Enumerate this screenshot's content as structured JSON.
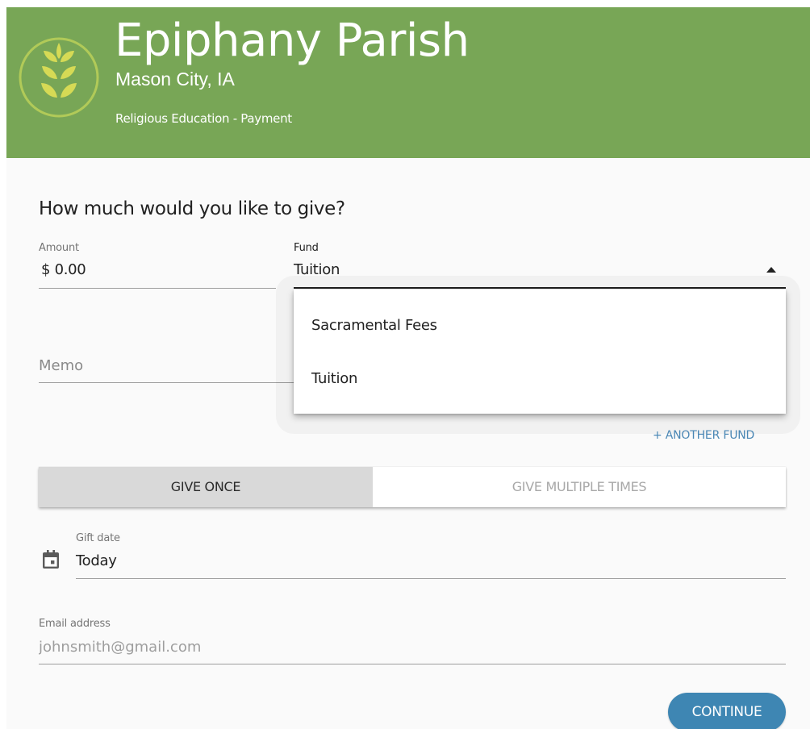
{
  "header": {
    "title": "Epiphany Parish",
    "location": "Mason City, IA",
    "page_name": "Religious Education - Payment",
    "logo_icon": "wheat-icon",
    "background_color": "#78a656"
  },
  "form": {
    "question": "How much would you like to give?",
    "amount": {
      "label": "Amount",
      "currency": "$",
      "value": "0.00"
    },
    "fund": {
      "label": "Fund",
      "selected": "Tuition",
      "options": [
        "Sacramental Fees",
        "Tuition"
      ],
      "dropdown_open": true
    },
    "memo": {
      "placeholder": "Memo"
    },
    "another_fund_link": "+ ANOTHER FUND",
    "frequency": {
      "once_label": "GIVE ONCE",
      "multiple_label": "GIVE MULTIPLE TIMES",
      "selected": "once"
    },
    "gift_date": {
      "label": "Gift date",
      "value": "Today",
      "icon": "calendar-icon"
    },
    "email": {
      "label": "Email address",
      "placeholder": "johnsmith@gmail.com"
    },
    "continue_label": "CONTINUE"
  },
  "colors": {
    "accent": "#3e86b3",
    "link": "#4a87b5",
    "selected_toggle": "#d9d9d9"
  }
}
